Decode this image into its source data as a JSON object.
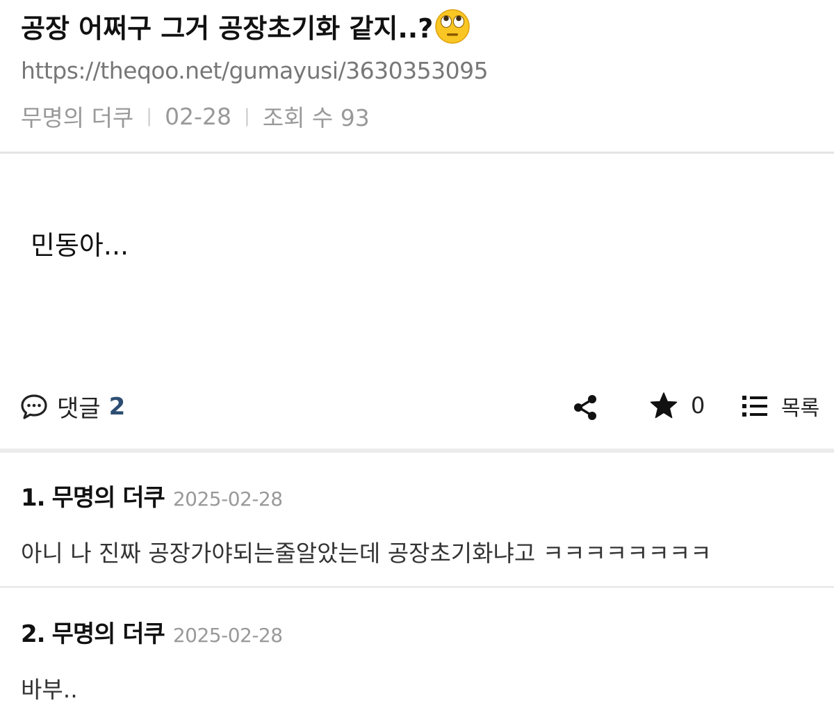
{
  "post": {
    "title": "공장 어쩌구 그거 공장초기화 같지..?",
    "title_emoji": "face-with-rolling-eyes-emoji",
    "url": "https://theqoo.net/gumayusi/3630353095",
    "author": "무명의 더쿠",
    "date": "02-28",
    "views_label": "조회 수 93",
    "body": "민동아..."
  },
  "actions": {
    "comments_label": "댓글",
    "comments_count": "2",
    "share_icon": "share-icon",
    "star_count": "0",
    "list_label": "목록"
  },
  "comments": [
    {
      "number": "1.",
      "author": "무명의 더쿠",
      "date": "2025-02-28",
      "text": "아니 나 진짜 공장가야되는줄알았는데 공장초기화냐고 ㅋㅋㅋㅋㅋㅋㅋㅋ"
    },
    {
      "number": "2.",
      "author": "무명의 더쿠",
      "date": "2025-02-28",
      "text": "바부.."
    }
  ],
  "colors": {
    "comment_count": "#2d4e72",
    "meta_text": "#999999",
    "divider": "#e4e4e4"
  }
}
